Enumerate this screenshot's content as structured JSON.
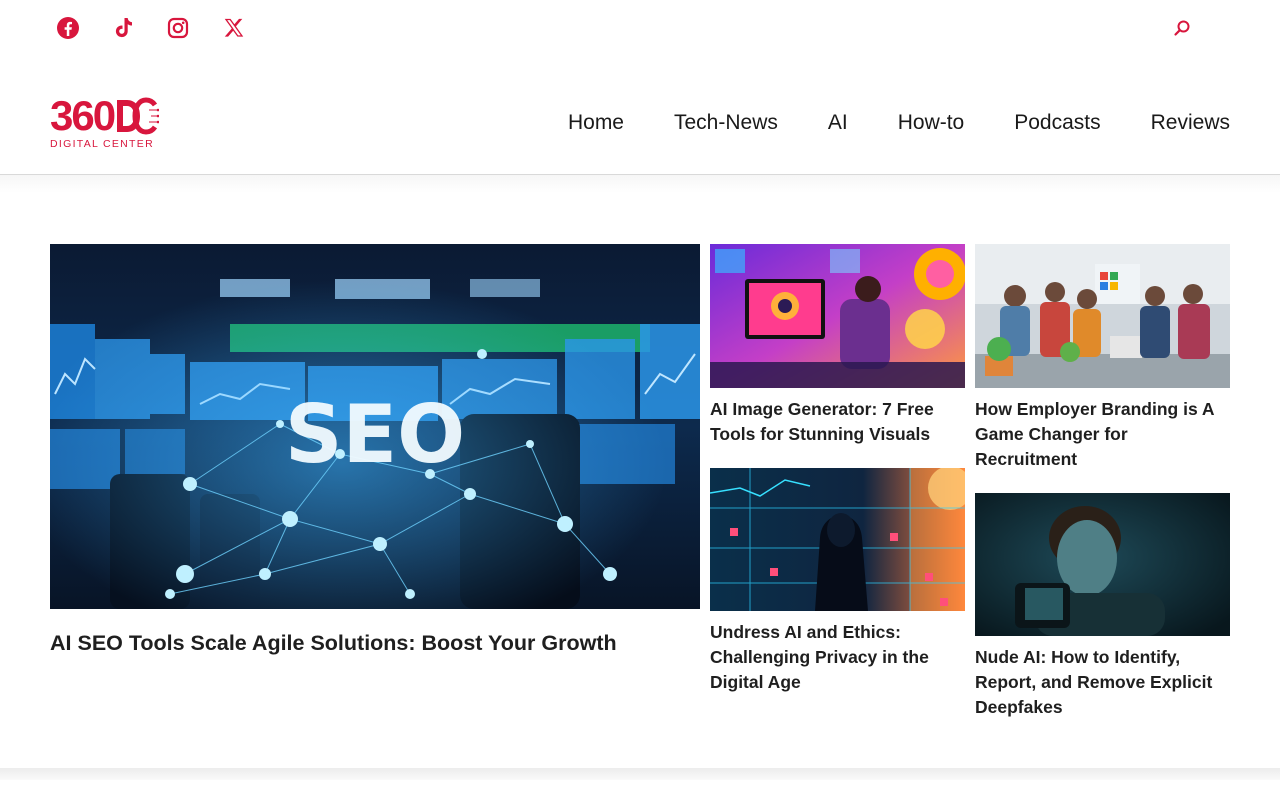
{
  "social": [
    {
      "name": "facebook-icon",
      "label": "Facebook"
    },
    {
      "name": "tiktok-icon",
      "label": "TikTok"
    },
    {
      "name": "instagram-icon",
      "label": "Instagram"
    },
    {
      "name": "x-icon",
      "label": "X"
    }
  ],
  "brand": {
    "logo_number": "360",
    "logo_letters": "DC",
    "tagline": "DIGITAL CENTER",
    "accent_color": "#d8163d"
  },
  "nav": {
    "items": [
      "Home",
      "Tech-News",
      "AI",
      "How-to",
      "Podcasts",
      "Reviews"
    ]
  },
  "posts": {
    "featured": {
      "title": "AI SEO Tools Scale Agile Solutions: Boost Your Growth",
      "image_text": "SEO"
    },
    "grid": [
      {
        "title": "AI Image Generator: 7 Free Tools for Stunning Visuals"
      },
      {
        "title": "How Employer Branding is A Game Changer for Recruitment"
      },
      {
        "title": "Undress AI and Ethics: Challenging Privacy in the Digital Age"
      },
      {
        "title": "Nude AI: How to Identify, Report, and Remove Explicit Deepfakes"
      }
    ]
  }
}
